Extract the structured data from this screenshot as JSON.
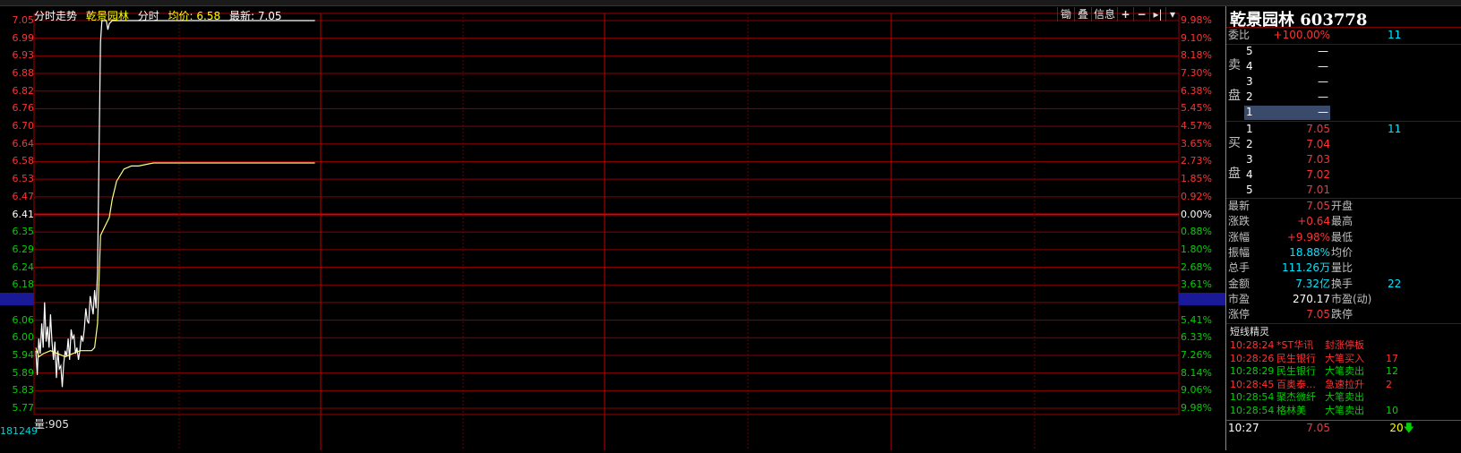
{
  "chart_header": {
    "mode": "分时走势",
    "stock": "乾景园林",
    "view": "分时",
    "avg_label": "均价:",
    "avg_value": "6.58",
    "latest_label": "最新:",
    "latest_value": "7.05"
  },
  "toolbar": [
    "锄",
    "叠",
    "信息",
    "+",
    "−",
    "▸|",
    "▾"
  ],
  "price_ticks": [
    "7.05",
    "6.99",
    "6.93",
    "6.88",
    "6.82",
    "6.76",
    "6.70",
    "6.64",
    "6.58",
    "6.53",
    "6.47",
    "6.41",
    "6.35",
    "6.29",
    "6.24",
    "6.18",
    "6.13",
    "6.06",
    "6.00",
    "5.94",
    "5.89",
    "5.83",
    "5.77"
  ],
  "pct_ticks": [
    "9.98%",
    "9.10%",
    "8.18%",
    "7.30%",
    "6.38%",
    "5.45%",
    "4.57%",
    "3.65%",
    "2.73%",
    "1.85%",
    "0.92%",
    "0.00%",
    "0.88%",
    "1.80%",
    "2.68%",
    "3.61%",
    "4.44%",
    "5.41%",
    "6.33%",
    "7.26%",
    "8.14%",
    "9.06%",
    "9.98%"
  ],
  "volume": {
    "label": "量:",
    "value": "905",
    "axis_value": "181249"
  },
  "chart_data": {
    "type": "line",
    "title": "分时走势",
    "xlabel": "",
    "ylabel": "",
    "ylim": [
      5.77,
      7.05
    ],
    "prev_close": 6.41,
    "highlight_price": 6.13,
    "series": [
      {
        "name": "分时",
        "color": "#ffffff",
        "x": [
          0,
          1,
          2,
          3,
          4,
          5,
          6,
          7,
          8,
          9,
          10,
          11,
          12,
          13,
          14,
          15,
          16,
          17,
          18,
          19,
          20,
          21,
          22,
          23,
          24,
          25,
          26,
          27,
          28,
          29,
          30,
          31,
          32,
          33,
          34,
          35,
          36,
          37,
          38,
          39,
          40,
          41,
          42,
          43,
          44,
          45,
          46,
          47,
          48,
          49,
          50,
          52,
          55,
          60,
          70,
          80,
          90,
          100,
          110,
          120,
          130,
          140,
          150,
          160,
          170,
          180,
          190
        ],
        "values": [
          5.96,
          5.88,
          6.0,
          5.95,
          6.05,
          5.97,
          6.12,
          5.99,
          6.04,
          5.97,
          6.08,
          5.99,
          5.93,
          5.99,
          5.87,
          5.96,
          5.9,
          5.91,
          5.84,
          5.92,
          5.96,
          5.94,
          6.0,
          5.93,
          6.03,
          6.0,
          6.01,
          5.95,
          5.97,
          5.93,
          5.96,
          6.01,
          5.99,
          6.03,
          6.1,
          6.06,
          6.05,
          6.14,
          6.11,
          6.08,
          6.16,
          6.1,
          6.22,
          6.6,
          6.98,
          7.05,
          7.05,
          7.05,
          7.05,
          7.02,
          7.04,
          7.05,
          7.05,
          7.05,
          7.05,
          7.05,
          7.05,
          7.05,
          7.05,
          7.05,
          7.05,
          7.05,
          7.05,
          7.05,
          7.05,
          7.05,
          7.05
        ]
      },
      {
        "name": "均价",
        "color": "#ffff80",
        "x": [
          0,
          2,
          5,
          10,
          15,
          20,
          25,
          30,
          35,
          38,
          40,
          42,
          44,
          46,
          48,
          50,
          52,
          55,
          60,
          65,
          70,
          80,
          90,
          100,
          110,
          120,
          130,
          140,
          150,
          160,
          170,
          180,
          190
        ],
        "values": [
          5.97,
          5.94,
          5.95,
          5.96,
          5.95,
          5.94,
          5.95,
          5.96,
          5.96,
          5.96,
          5.97,
          6.05,
          6.34,
          6.36,
          6.38,
          6.4,
          6.46,
          6.52,
          6.56,
          6.57,
          6.57,
          6.58,
          6.58,
          6.58,
          6.58,
          6.58,
          6.58,
          6.58,
          6.58,
          6.58,
          6.58,
          6.58,
          6.58
        ]
      }
    ]
  },
  "panel": {
    "title": "乾景园林 603778",
    "weibi_label": "委比",
    "weibi_value": "+100.00%",
    "weibi_extra": "11",
    "sell_label": [
      "卖",
      "盘"
    ],
    "sell": [
      {
        "level": "5",
        "price": "—"
      },
      {
        "level": "4",
        "price": "—"
      },
      {
        "level": "3",
        "price": "—"
      },
      {
        "level": "2",
        "price": "—"
      },
      {
        "level": "1",
        "price": "—"
      }
    ],
    "buy_label": [
      "买",
      "盘"
    ],
    "buy": [
      {
        "level": "1",
        "price": "7.05",
        "vol": "11"
      },
      {
        "level": "2",
        "price": "7.04",
        "vol": ""
      },
      {
        "level": "3",
        "price": "7.03",
        "vol": ""
      },
      {
        "level": "4",
        "price": "7.02",
        "vol": ""
      },
      {
        "level": "5",
        "price": "7.01",
        "vol": ""
      }
    ],
    "stats": [
      {
        "l": "最新",
        "v": "7.05",
        "vc": "red",
        "r": "开盘",
        "rv": ""
      },
      {
        "l": "涨跌",
        "v": "+0.64",
        "vc": "red",
        "r": "最高",
        "rv": ""
      },
      {
        "l": "涨幅",
        "v": "+9.98%",
        "vc": "red",
        "r": "最低",
        "rv": ""
      },
      {
        "l": "振幅",
        "v": "18.88%",
        "vc": "cyan",
        "r": "均价",
        "rv": ""
      },
      {
        "l": "总手",
        "v": "111.26万",
        "vc": "cyan",
        "r": "量比",
        "rv": ""
      },
      {
        "l": "金额",
        "v": "7.32亿",
        "vc": "cyan",
        "r": "换手",
        "rv": "22"
      },
      {
        "l": "市盈",
        "v": "270.17",
        "vc": "white",
        "r": "市盈(动)",
        "rv": ""
      },
      {
        "l": "涨停",
        "v": "7.05",
        "vc": "red",
        "r": "跌停",
        "rv": ""
      }
    ],
    "sprite_title": "短线精灵",
    "sprite": [
      {
        "t": "10:28:24",
        "s": "*ST华讯",
        "e": "封涨停板",
        "n": "",
        "c": "#ff3232"
      },
      {
        "t": "10:28:26",
        "s": "民生银行",
        "e": "大笔买入",
        "n": "17",
        "c": "#ff3232"
      },
      {
        "t": "10:28:29",
        "s": "民生银行",
        "e": "大笔卖出",
        "n": "12",
        "c": "#00d000"
      },
      {
        "t": "10:28:45",
        "s": "百奥泰…",
        "e": "急速拉升",
        "n": "2",
        "c": "#ff3232"
      },
      {
        "t": "10:28:54",
        "s": "聚杰微纤",
        "e": "大笔卖出",
        "n": "",
        "c": "#00d000"
      },
      {
        "t": "10:28:54",
        "s": "格林美",
        "e": "大笔卖出",
        "n": "10",
        "c": "#00d000"
      }
    ],
    "bottom": {
      "time": "10:27",
      "price": "7.05",
      "vol": "20"
    }
  }
}
